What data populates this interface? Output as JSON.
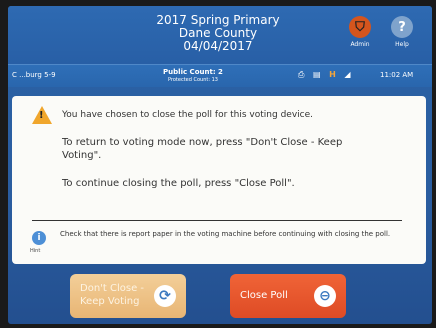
{
  "header": {
    "title_line1": "2017 Spring Primary",
    "title_line2": "Dane County",
    "title_line3": "04/04/2017",
    "admin_label": "Admin",
    "help_label": "Help",
    "admin_icon": "shield-icon",
    "help_icon": "question-icon"
  },
  "status_bar": {
    "precinct": "C ...burg 5-9",
    "public_count": "Public Count: 2",
    "protected_count": "Protected Count: 13",
    "time": "11:02 AM",
    "icons": [
      "printer-icon",
      "document-icon",
      "h-icon",
      "signal-icon"
    ]
  },
  "dialog": {
    "warning_icon": "warning-icon",
    "message_title": "You have chosen to close the poll for this voting device.",
    "return_instruction": "To return to voting mode now, press \"Don't Close - Keep Voting\".",
    "continue_instruction": "To continue closing the poll, press \"Close Poll\".",
    "hint_label": "Hint",
    "hint_text": "Check that there is report paper in the voting machine before continuing with closing the poll."
  },
  "buttons": {
    "keep_voting_label": "Don't Close - Keep Voting",
    "close_poll_label": "Close Poll"
  },
  "colors": {
    "background": "#2a5da0",
    "keep_button": "#f0c58c",
    "close_button": "#e5532b",
    "warning": "#f0a62c"
  }
}
